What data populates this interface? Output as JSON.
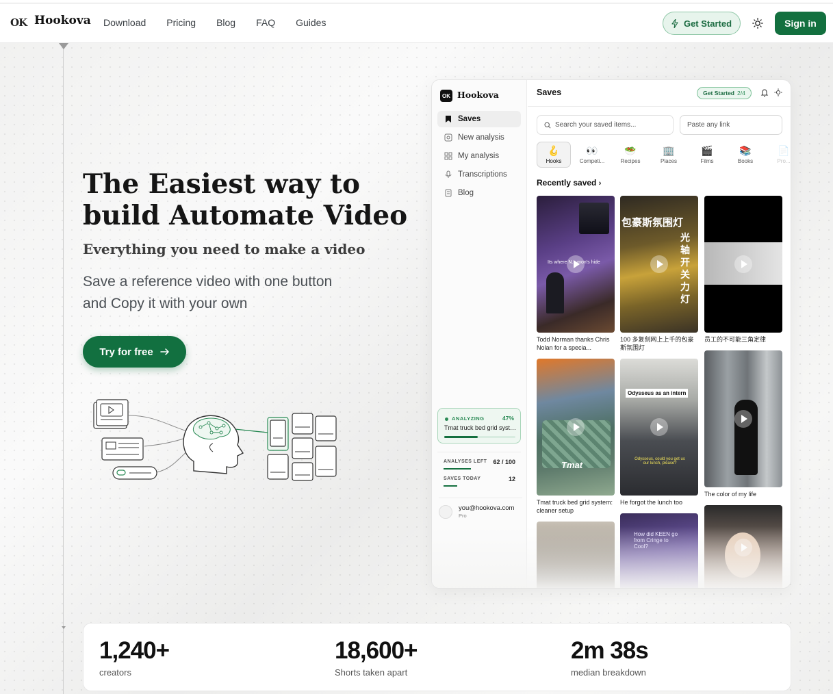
{
  "nav": {
    "logo_mark": "OK",
    "brand": "Hookova",
    "links": [
      "Download",
      "Pricing",
      "Blog",
      "FAQ",
      "Guides"
    ],
    "get_started": "Get Started",
    "sign_in": "Sign in"
  },
  "hero": {
    "headline_line1": "The Easiest way to",
    "headline_line2": "build Automate Video",
    "subhead": "Everything you need to make a video",
    "desc_line1": "Save a reference video with one button",
    "desc_line2": "and Copy it with your own",
    "cta": "Try for free"
  },
  "app": {
    "logo_mark": "OK",
    "brand": "Hookova",
    "sidebar_items": [
      "Saves",
      "New analysis",
      "My analysis",
      "Transcriptions",
      "Blog"
    ],
    "analyzing": {
      "label": "ANALYZING",
      "percent": "47%",
      "progress": 0.47,
      "title": "Tmat truck bed grid system: cleaner setup"
    },
    "analyses_left_label": "ANALYSES LEFT",
    "analyses_left_value": "62 / 100",
    "saves_today_label": "SAVES TODAY",
    "saves_today_value": "12",
    "user_email": "you@hookova.com",
    "user_plan": "Pro",
    "title": "Saves",
    "pill_label": "Get Started",
    "pill_fraction": "2/4",
    "search_placeholder": "Search your saved items...",
    "paste_placeholder": "Paste any link",
    "categories": [
      {
        "emoji": "🪝",
        "label": "Hooks"
      },
      {
        "emoji": "👀",
        "label": "Competi..."
      },
      {
        "emoji": "🥗",
        "label": "Recipes"
      },
      {
        "emoji": "🏢",
        "label": "Places"
      },
      {
        "emoji": "🎬",
        "label": "Films"
      },
      {
        "emoji": "📚",
        "label": "Books"
      },
      {
        "emoji": "📄",
        "label": "Pro..."
      }
    ],
    "recently_saved": "Recently saved",
    "captions": [
      "Todd Norman thanks Chris Nolan for a specia...",
      "100 多复刻网上上千的包豪斯氛围灯",
      "员工的不可能三角定律",
      "Tmat truck bed grid system: cleaner setup",
      "He forgot the lunch too",
      "The color of my life"
    ],
    "thumb_texts": {
      "t1": "Its where N... mon's hide",
      "t2_top": "包豪斯氛围灯",
      "t2_side": "光轴开关力灯",
      "t5_top": "Odysseus as an intern",
      "t5_sub": "Odysseus, could you get us our lunch, please?",
      "t4_logo": "Tmat",
      "t8": "How did KEEN go from Cringe to Cool?"
    }
  },
  "stats": [
    {
      "value": "1,240+",
      "label": "creators"
    },
    {
      "value": "18,600+",
      "label": "Shorts taken apart"
    },
    {
      "value": "2m 38s",
      "label": "median breakdown"
    }
  ]
}
